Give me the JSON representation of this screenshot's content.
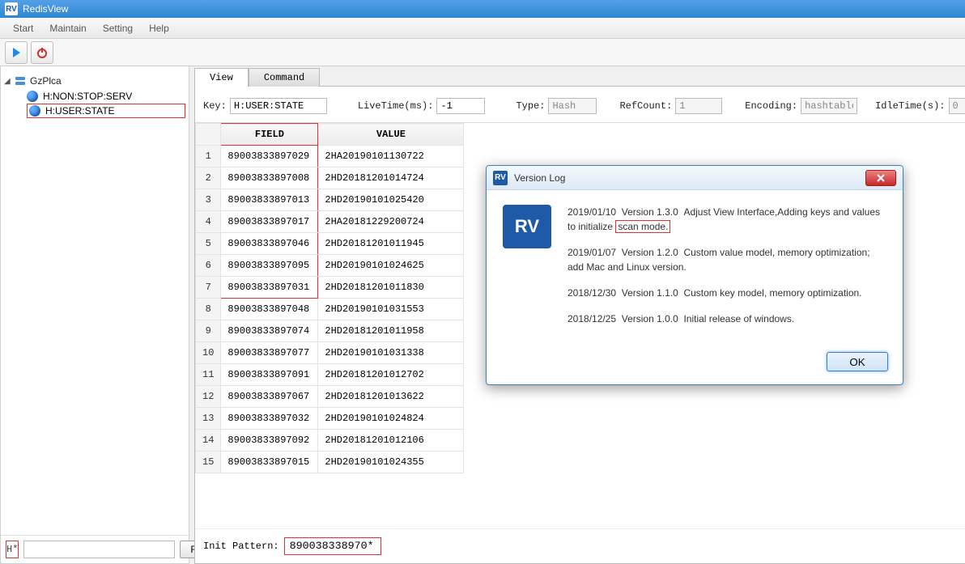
{
  "window": {
    "title": "RedisView"
  },
  "menu": {
    "start": "Start",
    "maintain": "Maintain",
    "setting": "Setting",
    "help": "Help"
  },
  "sidebar": {
    "root": "GzPlca",
    "keys": [
      "H:NON:STOP:SERV",
      "H:USER:STATE"
    ],
    "filter_prefix": "H*",
    "filter_value": "",
    "refresh": "Refresh"
  },
  "tabs": {
    "view": "View",
    "command": "Command"
  },
  "info": {
    "key_label": "Key:",
    "key": "H:USER:STATE",
    "livetime_label": "LiveTime(ms):",
    "livetime": "-1",
    "type_label": "Type:",
    "type": "Hash",
    "refcount_label": "RefCount:",
    "refcount": "1",
    "encoding_label": "Encoding:",
    "encoding": "hashtable",
    "idletime_label": "IdleTime(s):",
    "idletime": "0"
  },
  "table": {
    "headers": {
      "field": "FIELD",
      "value": "VALUE"
    },
    "rows": [
      {
        "n": "1",
        "f": "89003833897029",
        "v": "2HA20190101130722"
      },
      {
        "n": "2",
        "f": "89003833897008",
        "v": "2HD20181201014724"
      },
      {
        "n": "3",
        "f": "89003833897013",
        "v": "2HD20190101025420"
      },
      {
        "n": "4",
        "f": "89003833897017",
        "v": "2HA20181229200724"
      },
      {
        "n": "5",
        "f": "89003833897046",
        "v": "2HD20181201011945"
      },
      {
        "n": "6",
        "f": "89003833897095",
        "v": "2HD20190101024625"
      },
      {
        "n": "7",
        "f": "89003833897031",
        "v": "2HD20181201011830"
      },
      {
        "n": "8",
        "f": "89003833897048",
        "v": "2HD20190101031553"
      },
      {
        "n": "9",
        "f": "89003833897074",
        "v": "2HD20181201011958"
      },
      {
        "n": "10",
        "f": "89003833897077",
        "v": "2HD20190101031338"
      },
      {
        "n": "11",
        "f": "89003833897091",
        "v": "2HD20181201012702"
      },
      {
        "n": "12",
        "f": "89003833897067",
        "v": "2HD20181201013622"
      },
      {
        "n": "13",
        "f": "89003833897032",
        "v": "2HD20190101024824"
      },
      {
        "n": "14",
        "f": "89003833897092",
        "v": "2HD20181201012106"
      },
      {
        "n": "15",
        "f": "89003833897015",
        "v": "2HD20190101024355"
      }
    ]
  },
  "init": {
    "label": "Init Pattern:",
    "value": "890038338970*"
  },
  "dialog": {
    "title": "Version Log",
    "entries": [
      {
        "date": "2019/01/10",
        "ver": "Version 1.3.0",
        "text_a": "Adjust View Interface,Adding keys and values to initialize ",
        "text_b": "scan mode."
      },
      {
        "date": "2019/01/07",
        "ver": "Version 1.2.0",
        "text_a": "Custom value model, memory optimization; add Mac and Linux version.",
        "text_b": ""
      },
      {
        "date": "2018/12/30",
        "ver": "Version 1.1.0",
        "text_a": "Custom key model, memory optimization.",
        "text_b": ""
      },
      {
        "date": "2018/12/25",
        "ver": "Version 1.0.0",
        "text_a": "Initial release of windows.",
        "text_b": ""
      }
    ],
    "ok": "OK"
  }
}
